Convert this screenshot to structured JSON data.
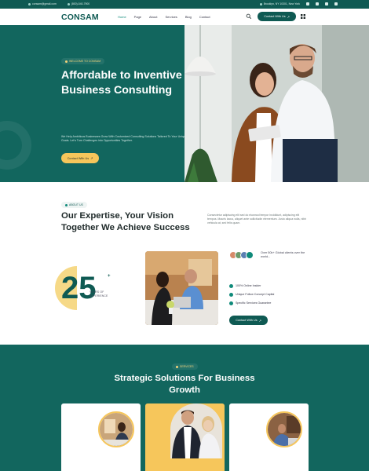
{
  "topbar": {
    "email": "consam@gmail.com",
    "phone": "(800)-540-7900",
    "address": "Brooklyn, NY 10301, New York",
    "social_icons": [
      "facebook-icon",
      "twitter-icon",
      "instagram-icon",
      "x-icon"
    ]
  },
  "nav": {
    "logo": "CONSAM",
    "items": [
      "Home",
      "Page",
      "About",
      "Services",
      "Blog",
      "Contact"
    ],
    "active": "Home",
    "cta": "Contact With Us"
  },
  "hero": {
    "tag": "WELCOME TO CONSAM",
    "title": "Affordable to Inventive Business Consulting",
    "description": "We Help Ambitious Businesses Grow With Customized Consulting Solutions Tailored To Your Unique Goals. Let's Turn Challenges into Opportunities Together.",
    "button": "Contact With Us"
  },
  "about": {
    "tag": "ABOUT US",
    "title": "Our Expertise, Your Vision Together We Achieve Success",
    "description": "Consectetur adipiscing elit sed do eiusmod tempor incididunt, adipiscing elit tempus. Mauris lacus, aliquet ante sollicitudin elementum. Justo aliqua nulla, nibh vehicula at, sed felis quam.",
    "years": "25",
    "years_plus": "+",
    "years_caption": "YEARS OF EXPERIENCE",
    "clients_text": "Over 50k+ Global clients over the world...",
    "checklist": [
      "100% Online Insider",
      "Unique Follow Concept Capital",
      "Specific Services Guarantee"
    ],
    "button": "Contact With Us"
  },
  "services": {
    "tag": "SERVICES",
    "title": "Strategic Solutions For Business Growth"
  },
  "colors": {
    "primary": "#12665e",
    "accent": "#f6c65b"
  }
}
